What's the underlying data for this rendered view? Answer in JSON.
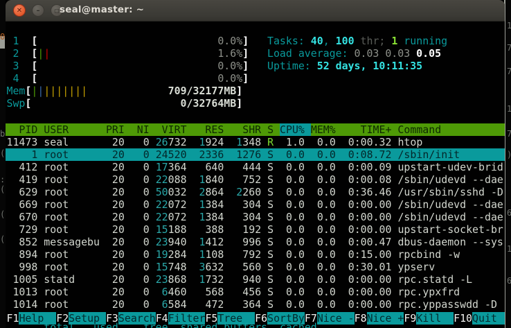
{
  "window": {
    "title": "seal@master: ~"
  },
  "meters": {
    "cpus": [
      {
        "id": "1",
        "pct": "0.0%",
        "bars": []
      },
      {
        "id": "2",
        "pct": "1.6%",
        "bars": [
          "green",
          "red"
        ]
      },
      {
        "id": "3",
        "pct": "0.0%",
        "bars": []
      },
      {
        "id": "4",
        "pct": "0.0%",
        "bars": []
      }
    ],
    "mem": {
      "label": "Mem",
      "value": "709/32177MB",
      "bars": [
        "green",
        "blue",
        "yellow",
        "yellow",
        "yellow",
        "yellow",
        "yellow",
        "yellow",
        "yellow"
      ]
    },
    "swp": {
      "label": "Swp",
      "value": "0/32764MB",
      "bars": []
    }
  },
  "stats": {
    "tasks": {
      "label": "Tasks:",
      "count": "40",
      "sep": ", ",
      "threads": "100",
      "thr_word": "thr;",
      "running_count": "1",
      "running_word": "running"
    },
    "load": {
      "label": "Load average:",
      "values": [
        "0.03",
        "0.03",
        "0.05"
      ]
    },
    "uptime": {
      "label": "Uptime:",
      "value": "52 days, 10:11:35"
    }
  },
  "table": {
    "columns": [
      "PID",
      "USER",
      "PRI",
      "NI",
      "VIRT",
      "RES",
      "SHR",
      "S",
      "CPU%",
      "MEM%",
      "TIME+",
      "Command"
    ],
    "sort_column": "CPU%",
    "rows": [
      {
        "pid": "11473",
        "user": "seal",
        "pri": "20",
        "ni": "0",
        "virt": "26732",
        "res": "1924",
        "shr": "1348",
        "s": "R",
        "cpu": "1.0",
        "mem": "0.0",
        "time": "0:00.32",
        "cmd": "htop",
        "selected": false
      },
      {
        "pid": "1",
        "user": "root",
        "pri": "20",
        "ni": "0",
        "virt": "24520",
        "res": "2336",
        "shr": "1276",
        "s": "S",
        "cpu": "0.0",
        "mem": "0.0",
        "time": "0:08.72",
        "cmd": "/sbin/init",
        "selected": true
      },
      {
        "pid": "412",
        "user": "root",
        "pri": "20",
        "ni": "0",
        "virt": "17364",
        "res": "640",
        "shr": "444",
        "s": "S",
        "cpu": "0.0",
        "mem": "0.0",
        "time": "0:00.09",
        "cmd": "upstart-udev-brid",
        "selected": false
      },
      {
        "pid": "419",
        "user": "root",
        "pri": "20",
        "ni": "0",
        "virt": "22088",
        "res": "1840",
        "shr": "752",
        "s": "S",
        "cpu": "0.0",
        "mem": "0.0",
        "time": "0:00.08",
        "cmd": "/sbin/udevd --dae",
        "selected": false
      },
      {
        "pid": "629",
        "user": "root",
        "pri": "20",
        "ni": "0",
        "virt": "50032",
        "res": "2864",
        "shr": "2260",
        "s": "S",
        "cpu": "0.0",
        "mem": "0.0",
        "time": "0:36.46",
        "cmd": "/usr/sbin/sshd -D",
        "selected": false
      },
      {
        "pid": "669",
        "user": "root",
        "pri": "20",
        "ni": "0",
        "virt": "22072",
        "res": "1384",
        "shr": "304",
        "s": "S",
        "cpu": "0.0",
        "mem": "0.0",
        "time": "0:00.00",
        "cmd": "/sbin/udevd --dae",
        "selected": false
      },
      {
        "pid": "670",
        "user": "root",
        "pri": "20",
        "ni": "0",
        "virt": "22072",
        "res": "1384",
        "shr": "304",
        "s": "S",
        "cpu": "0.0",
        "mem": "0.0",
        "time": "0:00.00",
        "cmd": "/sbin/udevd --dae",
        "selected": false
      },
      {
        "pid": "729",
        "user": "root",
        "pri": "20",
        "ni": "0",
        "virt": "15188",
        "res": "388",
        "shr": "192",
        "s": "S",
        "cpu": "0.0",
        "mem": "0.0",
        "time": "0:00.00",
        "cmd": "upstart-socket-br",
        "selected": false
      },
      {
        "pid": "852",
        "user": "messagebu",
        "pri": "20",
        "ni": "0",
        "virt": "23940",
        "res": "1412",
        "shr": "996",
        "s": "S",
        "cpu": "0.0",
        "mem": "0.0",
        "time": "0:00.47",
        "cmd": "dbus-daemon --sys",
        "selected": false
      },
      {
        "pid": "894",
        "user": "root",
        "pri": "20",
        "ni": "0",
        "virt": "19284",
        "res": "1108",
        "shr": "792",
        "s": "S",
        "cpu": "0.0",
        "mem": "0.0",
        "time": "0:15.00",
        "cmd": "rpcbind -w",
        "selected": false
      },
      {
        "pid": "998",
        "user": "root",
        "pri": "20",
        "ni": "0",
        "virt": "15748",
        "res": "3632",
        "shr": "560",
        "s": "S",
        "cpu": "0.0",
        "mem": "0.0",
        "time": "0:30.01",
        "cmd": "ypserv",
        "selected": false
      },
      {
        "pid": "1005",
        "user": "statd",
        "pri": "20",
        "ni": "0",
        "virt": "23868",
        "res": "1732",
        "shr": "940",
        "s": "S",
        "cpu": "0.0",
        "mem": "0.0",
        "time": "0:00.00",
        "cmd": "rpc.statd -L",
        "selected": false
      },
      {
        "pid": "1013",
        "user": "root",
        "pri": "20",
        "ni": "0",
        "virt": "6460",
        "res": "568",
        "shr": "456",
        "s": "S",
        "cpu": "0.0",
        "mem": "0.0",
        "time": "0:00.00",
        "cmd": "rpc.ypxfrd",
        "selected": false
      },
      {
        "pid": "1014",
        "user": "root",
        "pri": "20",
        "ni": "0",
        "virt": "6584",
        "res": "472",
        "shr": "364",
        "s": "S",
        "cpu": "0.0",
        "mem": "0.0",
        "time": "0:00.00",
        "cmd": "rpc.yppasswdd -D",
        "selected": false
      }
    ]
  },
  "fkeys": [
    {
      "key": "F1",
      "label": "Help"
    },
    {
      "key": "F2",
      "label": "Setup"
    },
    {
      "key": "F3",
      "label": "Search"
    },
    {
      "key": "F4",
      "label": "Filter"
    },
    {
      "key": "F5",
      "label": "Tree"
    },
    {
      "key": "F6",
      "label": "SortBy"
    },
    {
      "key": "F7",
      "label": "Nice -"
    },
    {
      "key": "F8",
      "label": "Nice +"
    },
    {
      "key": "F9",
      "label": "Kill"
    },
    {
      "key": "F10",
      "label": "Quit"
    }
  ],
  "background_text": {
    "bottom_line": "      total   used    free  shared buffers  cached",
    "left_marks": [
      "0",
      "b",
      "(",
      ":(",
      "(",
      "("
    ],
    "right_marks": [
      "1",
      "7",
      "7",
      "1",
      "7",
      ")",
      "6",
      "1",
      "6"
    ]
  }
}
